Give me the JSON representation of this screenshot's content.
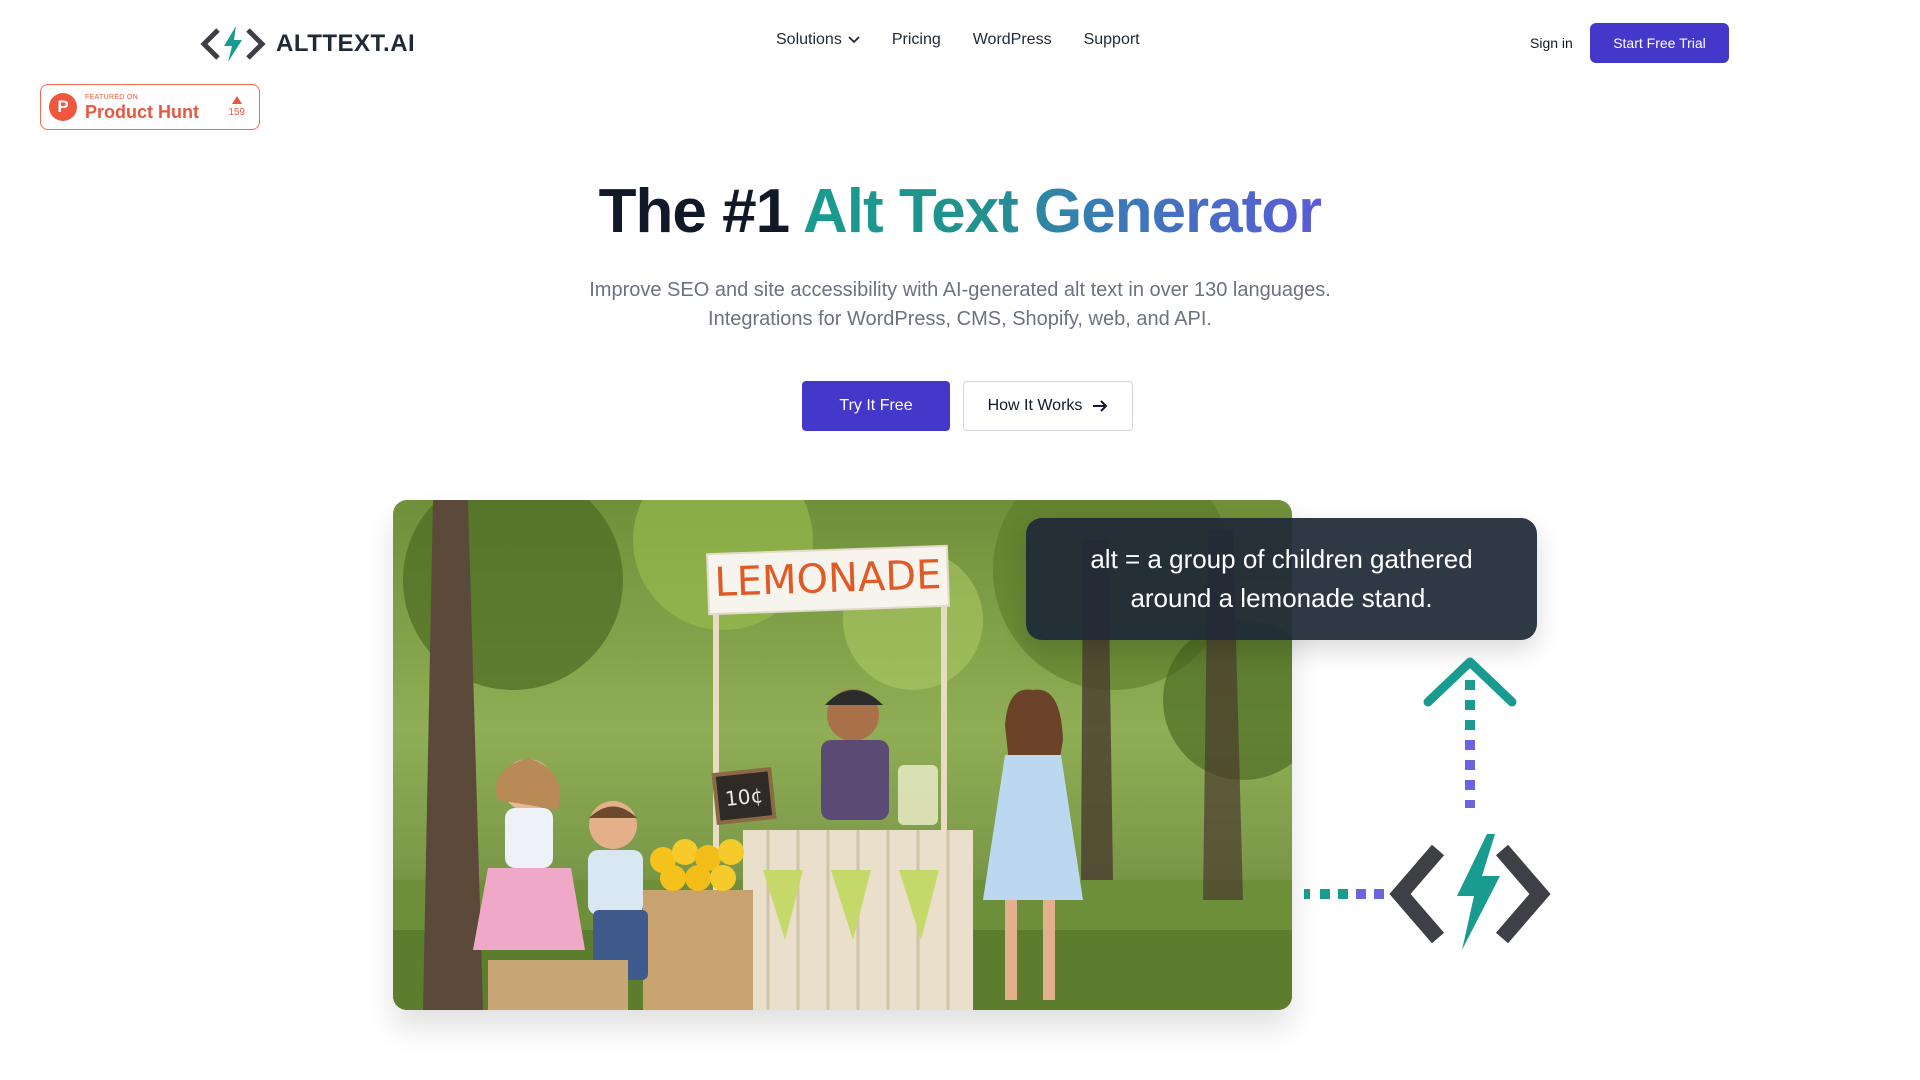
{
  "header": {
    "logo_text": "ALTTEXT.AI",
    "nav": [
      {
        "label": "Solutions",
        "has_dropdown": true
      },
      {
        "label": "Pricing"
      },
      {
        "label": "WordPress"
      },
      {
        "label": "Support"
      }
    ],
    "sign_in": "Sign in",
    "start_trial": "Start Free Trial"
  },
  "product_hunt": {
    "featured": "FEATURED ON",
    "name": "Product Hunt",
    "votes": "159",
    "logo_letter": "P"
  },
  "hero": {
    "title_plain": "The #1 ",
    "title_highlight": "Alt Text Generator",
    "subtitle_line1": "Improve SEO and site accessibility with AI-generated alt text in over 130 languages.",
    "subtitle_line2": "Integrations for WordPress, CMS, Shopify, web, and API.",
    "try_button": "Try It Free",
    "how_button": "How It Works"
  },
  "illustration": {
    "stand_sign": "LEMONADE",
    "price_board": "10¢",
    "alt_text": "alt = a group of children gathered around a lemonade stand."
  },
  "colors": {
    "primary": "#4338ca",
    "teal": "#1a9b8f",
    "purple": "#6b63e0",
    "product_hunt": "#f0573e"
  },
  "icons": [
    "logo-icon",
    "chevron-down-icon",
    "arrow-right-icon",
    "product-hunt-icon",
    "upvote-icon",
    "code-bolt-icon"
  ]
}
